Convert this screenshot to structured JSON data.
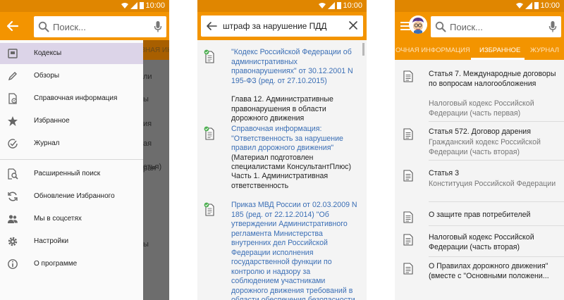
{
  "status_time": "10:00",
  "search_placeholder": "Поиск...",
  "drawer": {
    "items": [
      {
        "label": "Кодексы"
      },
      {
        "label": "Обзоры"
      },
      {
        "label": "Справочная информация"
      },
      {
        "label": "Избранное"
      },
      {
        "label": "Журнал"
      },
      {
        "label": "Расширенный поиск"
      },
      {
        "label": "Обновление Избранного"
      },
      {
        "label": "Мы в соцсетях"
      },
      {
        "label": "Настройки"
      },
      {
        "label": "О программе"
      }
    ]
  },
  "behind_drawer": {
    "tab": "ЗНАЯ ИНФ",
    "fragments": [
      "ли",
      "ы",
      "ия",
      "ая",
      "рая",
      "етья)",
      "ы"
    ]
  },
  "search_results": {
    "query": "штраф за нарушение ПДД",
    "results": [
      {
        "link": "\"Кодекс Российской Федерации об административных правонарушениях\" от 30.12.2001 N 195-ФЗ (ред. от 27.10.2015)",
        "sub": "Глава 12. Административные правонарушения в области дорожного движения"
      },
      {
        "link": "Справочная информация: \"Ответственность за нарушение правил дорожного движения\"",
        "link_tail": " (Материал подготовлен специалистами КонсультантПлюс)",
        "sub": "Часть 1. Административная ответственность"
      },
      {
        "link": "Приказ МВД России от 02.03.2009 N 185 (ред. от 22.12.2014) \"Об утверждении Административного регламента Министерства внутренних дел Российской Федерации исполнения государственной функции по контролю и надзору за соблюдением участниками дорожного движения требований в области обеспечения безопасности",
        "sub": ""
      }
    ]
  },
  "favorites": {
    "tabs": [
      {
        "label": "ОЧНАЯ ИНФОРМАЦИЯ"
      },
      {
        "label": "ИЗБРАННОЕ"
      },
      {
        "label": "ЖУРНАЛ"
      }
    ],
    "items": [
      {
        "title": "Статья 7. Международные договоры по вопросам налогообложения",
        "subtitle": "Налоговый кодекс Российской Федерации (часть первая)"
      },
      {
        "title": "Статья 572. Договор дарения",
        "subtitle": "Гражданский кодекс Российской Федерации (часть вторая)"
      },
      {
        "title": "Статья 3",
        "subtitle": "Конституция Российской Федерации"
      },
      {
        "title": "О защите прав потребителей",
        "subtitle": ""
      },
      {
        "title": "Налоговый кодекс Российской Федерации (часть вторая)",
        "subtitle": ""
      },
      {
        "title": "О Правилах дорожного движения\" (вместе с \"Основными положени...",
        "subtitle": ""
      }
    ]
  },
  "colors": {
    "accent": "#f39400",
    "status": "#e08600",
    "link": "#3a6eb5",
    "active_drawer_item": "#dcd4e8",
    "check": "#4caf50"
  }
}
